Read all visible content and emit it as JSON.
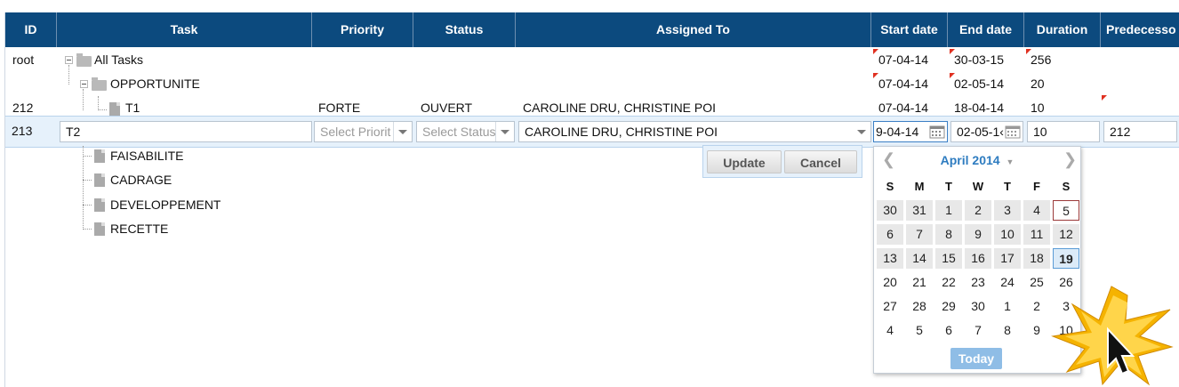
{
  "columns": [
    "ID",
    "Task",
    "Priority",
    "Status",
    "Assigned To",
    "Start date",
    "End date",
    "Duration",
    "Predecesso"
  ],
  "rows": [
    {
      "id": "root",
      "task": "All Tasks",
      "priority": "",
      "status": "",
      "assigned": "",
      "start": "07-04-14",
      "end": "30-03-15",
      "duration": "256"
    },
    {
      "id": "",
      "task": "OPPORTUNITE",
      "priority": "",
      "status": "",
      "assigned": "",
      "start": "07-04-14",
      "end": "02-05-14",
      "duration": "20"
    },
    {
      "id": "212",
      "task": "T1",
      "priority": "FORTE",
      "status": "OUVERT",
      "assigned": "CAROLINE DRU, CHRISTINE POI",
      "start": "07-04-14",
      "end": "18-04-14",
      "duration": "10"
    }
  ],
  "edit_row": {
    "id": "213",
    "task": "T2",
    "priority_placeholder": "Select Priorit",
    "status_placeholder": "Select Status",
    "assigned": "CAROLINE DRU, CHRISTINE POI",
    "start": "9-04-14",
    "end": "02-05-1‹",
    "duration": "10",
    "predecessor": "212"
  },
  "tree_items": [
    "FAISABILITE",
    "CADRAGE",
    "DEVELOPPEMENT",
    "RECETTE"
  ],
  "popup": {
    "update": "Update",
    "cancel": "Cancel"
  },
  "calendar": {
    "month_label": "April 2014",
    "prev": "❮",
    "next": "❯",
    "dow": [
      "S",
      "M",
      "T",
      "W",
      "T",
      "F",
      "S"
    ],
    "weeks": [
      [
        "30",
        "31",
        "1",
        "2",
        "3",
        "4",
        "5"
      ],
      [
        "6",
        "7",
        "8",
        "9",
        "10",
        "11",
        "12"
      ],
      [
        "13",
        "14",
        "15",
        "16",
        "17",
        "18",
        "19"
      ],
      [
        "20",
        "21",
        "22",
        "23",
        "24",
        "25",
        "26"
      ],
      [
        "27",
        "28",
        "29",
        "30",
        "1",
        "2",
        "3"
      ],
      [
        "4",
        "5",
        "6",
        "7",
        "8",
        "9",
        "10"
      ]
    ],
    "today_day": "5",
    "selected_day": "19",
    "today_button": "Today"
  },
  "colors": {
    "header_bg": "#0c4a7e",
    "edit_bg": "#e6f1fb",
    "accent": "#2e7cc0",
    "today_btn": "#8fbde6"
  },
  "icons": [
    "folder-icon",
    "document-icon",
    "collapse-icon",
    "calendar-icon",
    "dropdown-arrow-icon",
    "cursor-icon"
  ]
}
